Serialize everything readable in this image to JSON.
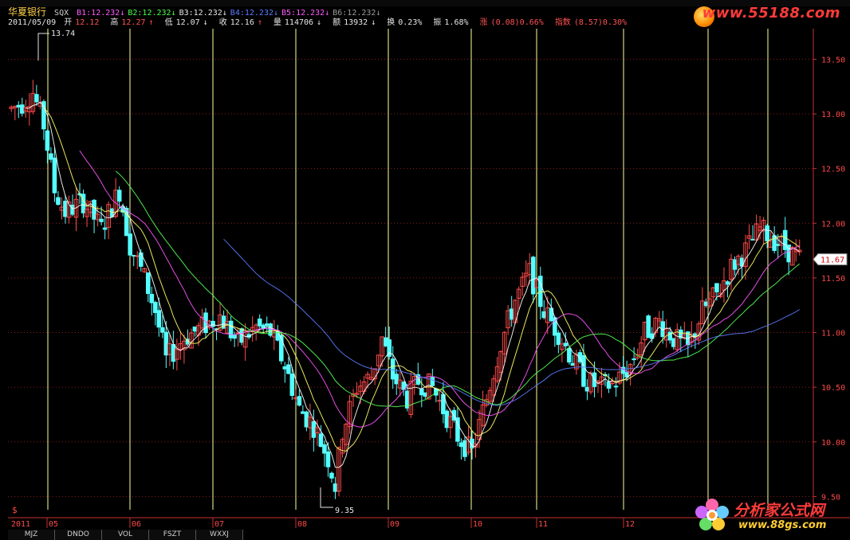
{
  "header": {
    "stock_name": "华夏银行",
    "indicator": "SQX",
    "b_values": [
      {
        "label": "B1:12.232",
        "arrow": "↓",
        "color": "#ff5bff"
      },
      {
        "label": "B2:12.232",
        "arrow": "↓",
        "color": "#4cff4c"
      },
      {
        "label": "B3:12.232",
        "arrow": "↓",
        "color": "#e6e6e6"
      },
      {
        "label": "B4:12.232",
        "arrow": "↓",
        "color": "#5b7bff"
      },
      {
        "label": "B5:12.232",
        "arrow": "↓",
        "color": "#ff5bff"
      },
      {
        "label": "B6:12.232",
        "arrow": "↓",
        "color": "#9a9a9a"
      }
    ],
    "date": "2011/05/09",
    "open_label": "开",
    "open_value": "12.12",
    "high_label": "高",
    "high_value": "12.27",
    "low_label": "低",
    "low_value": "12.07",
    "close_label": "收",
    "close_value": "12.16",
    "volume_label": "量",
    "volume_value": "114706",
    "amount_label": "额",
    "amount_value": "13932",
    "turnover_label": "换",
    "turnover_value": "0.23%",
    "amplitude_label": "振",
    "amplitude_value": "1.68%",
    "change_label": "涨",
    "change_value": "(0.08)0.66%",
    "index_label": "指数",
    "index_value": "(8.57)0.30%"
  },
  "logo_top": "www.55188.com",
  "logo_bottom": {
    "name": "分析家公式网",
    "url": "www.88gs.com"
  },
  "tabs": [
    "MJZ",
    "DNDO",
    "VOL",
    "FSZT",
    "WXXJ"
  ],
  "colors": {
    "up": "#ff4a4a",
    "down": "#55ffff",
    "axis": "#c83030",
    "grid": "#8a1f1f",
    "vline": "#ffff99"
  },
  "chart_data": {
    "type": "candlestick",
    "y_ticks": [
      9.5,
      10.0,
      10.5,
      11.0,
      11.5,
      12.0,
      12.5,
      13.0,
      13.5
    ],
    "ylim": [
      9.35,
      13.74
    ],
    "x_labels": [
      "2011",
      "05",
      "06",
      "07",
      "08",
      "09",
      "10",
      "11",
      "12"
    ],
    "max_marker": "13.74",
    "min_marker": "9.35",
    "current_price": "11.67",
    "year_marker": "$",
    "price_path": [
      [
        0,
        13.05
      ],
      [
        3,
        13.1
      ],
      [
        6,
        13.2
      ],
      [
        9,
        12.9
      ],
      [
        12,
        12.3
      ],
      [
        15,
        12.1
      ],
      [
        20,
        12.2
      ],
      [
        25,
        11.95
      ],
      [
        30,
        12.3
      ],
      [
        33,
        11.8
      ],
      [
        37,
        11.5
      ],
      [
        40,
        11.2
      ],
      [
        43,
        10.75
      ],
      [
        48,
        10.95
      ],
      [
        53,
        11.05
      ],
      [
        58,
        11.15
      ],
      [
        63,
        10.9
      ],
      [
        68,
        11.05
      ],
      [
        72,
        11.0
      ],
      [
        76,
        10.7
      ],
      [
        80,
        10.3
      ],
      [
        84,
        10.15
      ],
      [
        88,
        9.85
      ],
      [
        90,
        9.6
      ],
      [
        92,
        10.1
      ],
      [
        96,
        10.5
      ],
      [
        100,
        10.6
      ],
      [
        103,
        10.95
      ],
      [
        106,
        10.6
      ],
      [
        110,
        10.4
      ],
      [
        113,
        10.55
      ],
      [
        117,
        10.5
      ],
      [
        120,
        10.3
      ],
      [
        124,
        10.05
      ],
      [
        128,
        9.9
      ],
      [
        132,
        10.4
      ],
      [
        136,
        10.9
      ],
      [
        140,
        11.3
      ],
      [
        144,
        11.55
      ],
      [
        148,
        11.2
      ],
      [
        152,
        11.0
      ],
      [
        156,
        10.75
      ],
      [
        160,
        10.55
      ],
      [
        164,
        10.5
      ],
      [
        168,
        10.55
      ],
      [
        172,
        10.7
      ],
      [
        176,
        11.0
      ],
      [
        180,
        11.1
      ],
      [
        184,
        10.95
      ],
      [
        188,
        10.85
      ],
      [
        192,
        11.2
      ],
      [
        196,
        11.35
      ],
      [
        200,
        11.6
      ],
      [
        204,
        11.75
      ],
      [
        208,
        11.95
      ],
      [
        212,
        11.85
      ],
      [
        216,
        11.75
      ],
      [
        219,
        11.67
      ]
    ]
  }
}
